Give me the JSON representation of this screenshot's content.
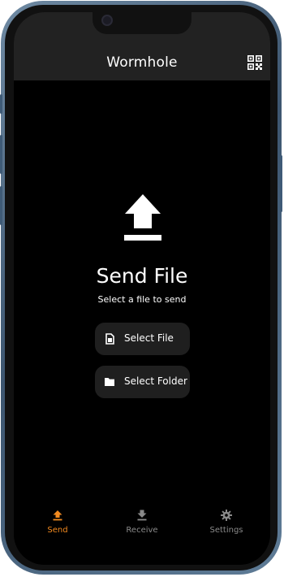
{
  "app": {
    "title": "Wormhole"
  },
  "header": {
    "action_icon": "qr-code-icon"
  },
  "main": {
    "icon": "upload-icon",
    "title": "Send File",
    "subtitle": "Select a file to send",
    "buttons": [
      {
        "label": "Select File",
        "icon": "file-icon"
      },
      {
        "label": "Select Folder",
        "icon": "folder-icon"
      }
    ]
  },
  "bottom_nav": {
    "active": "Send",
    "items": [
      {
        "label": "Send",
        "icon": "upload-icon"
      },
      {
        "label": "Receive",
        "icon": "download-icon"
      },
      {
        "label": "Settings",
        "icon": "gear-icon"
      }
    ]
  },
  "colors": {
    "accent": "#f28a1f",
    "background": "#000000",
    "appbar": "#222222",
    "button": "#1f1f1f",
    "frame": "#3d5670"
  }
}
